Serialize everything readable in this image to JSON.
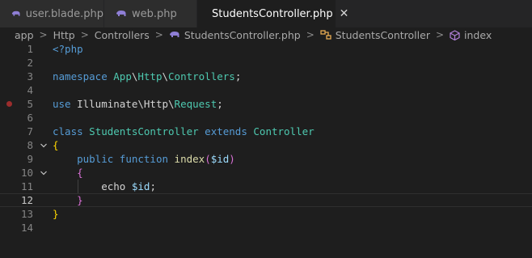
{
  "tabs": [
    {
      "label": "user.blade.php",
      "active": false
    },
    {
      "label": "web.php",
      "active": false
    },
    {
      "label": "StudentsController.php",
      "active": true,
      "close": "✕"
    }
  ],
  "breadcrumb": {
    "items": [
      "app",
      "Http",
      "Controllers",
      "StudentsController.php",
      "StudentsController",
      "index"
    ],
    "separator": ">"
  },
  "editor": {
    "breakpoint_line": 5,
    "current_line": 12,
    "fold_icon": "chevron-down-icon",
    "lines": [
      {
        "n": "1",
        "tokens": [
          {
            "t": "<?php",
            "c": "kw-blue"
          }
        ]
      },
      {
        "n": "2",
        "tokens": []
      },
      {
        "n": "3",
        "tokens": [
          {
            "t": "namespace",
            "c": "kw-blue"
          },
          {
            "t": " ",
            "c": "plain"
          },
          {
            "t": "App",
            "c": "ty"
          },
          {
            "t": "\\",
            "c": "plain"
          },
          {
            "t": "Http",
            "c": "ty"
          },
          {
            "t": "\\",
            "c": "plain"
          },
          {
            "t": "Controllers",
            "c": "ty"
          },
          {
            "t": ";",
            "c": "plain"
          }
        ]
      },
      {
        "n": "4",
        "tokens": []
      },
      {
        "n": "5",
        "tokens": [
          {
            "t": "use",
            "c": "kw-blue"
          },
          {
            "t": " Illuminate",
            "c": "plain"
          },
          {
            "t": "\\",
            "c": "plain"
          },
          {
            "t": "Http",
            "c": "plain"
          },
          {
            "t": "\\",
            "c": "plain"
          },
          {
            "t": "Request",
            "c": "ty"
          },
          {
            "t": ";",
            "c": "plain"
          }
        ]
      },
      {
        "n": "6",
        "tokens": []
      },
      {
        "n": "7",
        "tokens": [
          {
            "t": "class",
            "c": "kw-blue"
          },
          {
            "t": " ",
            "c": "plain"
          },
          {
            "t": "StudentsController",
            "c": "ty"
          },
          {
            "t": " ",
            "c": "plain"
          },
          {
            "t": "extends",
            "c": "kw-blue"
          },
          {
            "t": " ",
            "c": "plain"
          },
          {
            "t": "Controller",
            "c": "ty"
          }
        ]
      },
      {
        "n": "8",
        "tokens": [
          {
            "t": "{",
            "c": "brace-y"
          }
        ],
        "fold": true
      },
      {
        "n": "9",
        "tokens": [
          {
            "t": "    ",
            "c": "plain"
          },
          {
            "t": "public",
            "c": "kw-blue"
          },
          {
            "t": " ",
            "c": "plain"
          },
          {
            "t": "function",
            "c": "kw-blue"
          },
          {
            "t": " ",
            "c": "plain"
          },
          {
            "t": "index",
            "c": "fn"
          },
          {
            "t": "(",
            "c": "brace-p"
          },
          {
            "t": "$id",
            "c": "var"
          },
          {
            "t": ")",
            "c": "brace-p"
          }
        ]
      },
      {
        "n": "10",
        "tokens": [
          {
            "t": "    ",
            "c": "plain"
          },
          {
            "t": "{",
            "c": "brace-p"
          }
        ],
        "fold": true
      },
      {
        "n": "11",
        "tokens": [
          {
            "t": "        ",
            "c": "plain"
          },
          {
            "t": "echo",
            "c": "plain"
          },
          {
            "t": " ",
            "c": "plain"
          },
          {
            "t": "$id",
            "c": "var"
          },
          {
            "t": ";",
            "c": "plain"
          }
        ]
      },
      {
        "n": "12",
        "tokens": [
          {
            "t": "    ",
            "c": "plain"
          },
          {
            "t": "}",
            "c": "brace-p"
          }
        ]
      },
      {
        "n": "13",
        "tokens": [
          {
            "t": "}",
            "c": "brace-y"
          }
        ]
      },
      {
        "n": "14",
        "tokens": []
      }
    ]
  },
  "colors": {
    "background": "#1e1e1e",
    "tab_inactive": "#2d2d2d",
    "php_icon": "#8f7fd6",
    "breakpoint": "#9b2d2d"
  }
}
